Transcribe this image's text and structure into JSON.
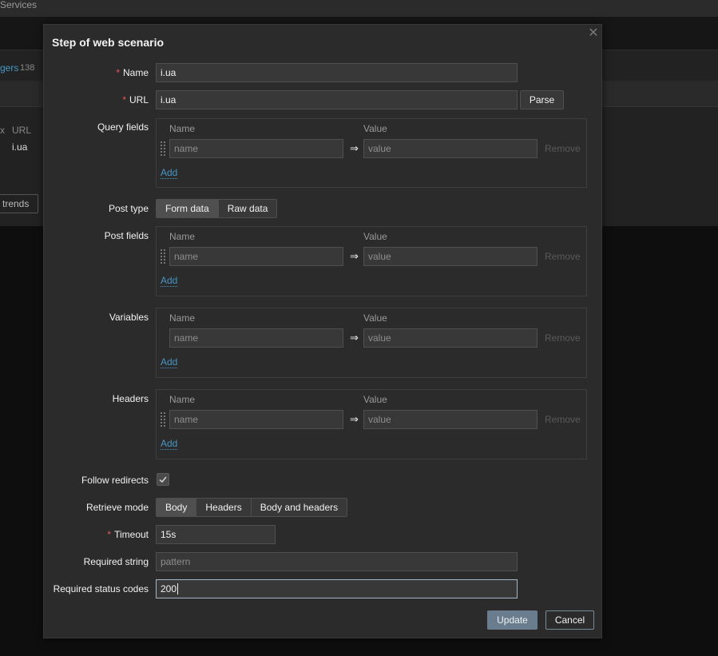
{
  "background": {
    "topbar_text": "Services",
    "triggers_link": "gers",
    "triggers_count": "138",
    "x_mark": "x",
    "url_header": "URL",
    "url_value": "i.ua",
    "trends_button": "trends"
  },
  "dialog": {
    "title": "Step of web scenario",
    "close_icon": "close-icon",
    "name": {
      "label": "Name",
      "required": "*",
      "value": "i.ua"
    },
    "url": {
      "label": "URL",
      "required": "*",
      "value": "i.ua",
      "parse_button": "Parse"
    },
    "query_fields": {
      "label": "Query fields",
      "col_name": "Name",
      "col_value": "Value",
      "row": {
        "name_placeholder": "name",
        "value_placeholder": "value",
        "arrow": "⇒",
        "remove": "Remove"
      },
      "add": "Add"
    },
    "post_type": {
      "label": "Post type",
      "options": [
        "Form data",
        "Raw data"
      ],
      "selected": "Form data"
    },
    "post_fields": {
      "label": "Post fields",
      "col_name": "Name",
      "col_value": "Value",
      "row": {
        "name_placeholder": "name",
        "value_placeholder": "value",
        "arrow": "⇒",
        "remove": "Remove"
      },
      "add": "Add"
    },
    "variables": {
      "label": "Variables",
      "col_name": "Name",
      "col_value": "Value",
      "row": {
        "name_placeholder": "name",
        "value_placeholder": "value",
        "arrow": "⇒",
        "remove": "Remove"
      },
      "add": "Add"
    },
    "headers": {
      "label": "Headers",
      "col_name": "Name",
      "col_value": "Value",
      "row": {
        "name_placeholder": "name",
        "value_placeholder": "value",
        "arrow": "⇒",
        "remove": "Remove"
      },
      "add": "Add"
    },
    "follow_redirects": {
      "label": "Follow redirects",
      "checked": true
    },
    "retrieve_mode": {
      "label": "Retrieve mode",
      "options": [
        "Body",
        "Headers",
        "Body and headers"
      ],
      "selected": "Body"
    },
    "timeout": {
      "label": "Timeout",
      "required": "*",
      "value": "15s"
    },
    "required_string": {
      "label": "Required string",
      "placeholder": "pattern"
    },
    "required_status_codes": {
      "label": "Required status codes",
      "value": "200"
    },
    "update_button": "Update",
    "cancel_button": "Cancel"
  }
}
